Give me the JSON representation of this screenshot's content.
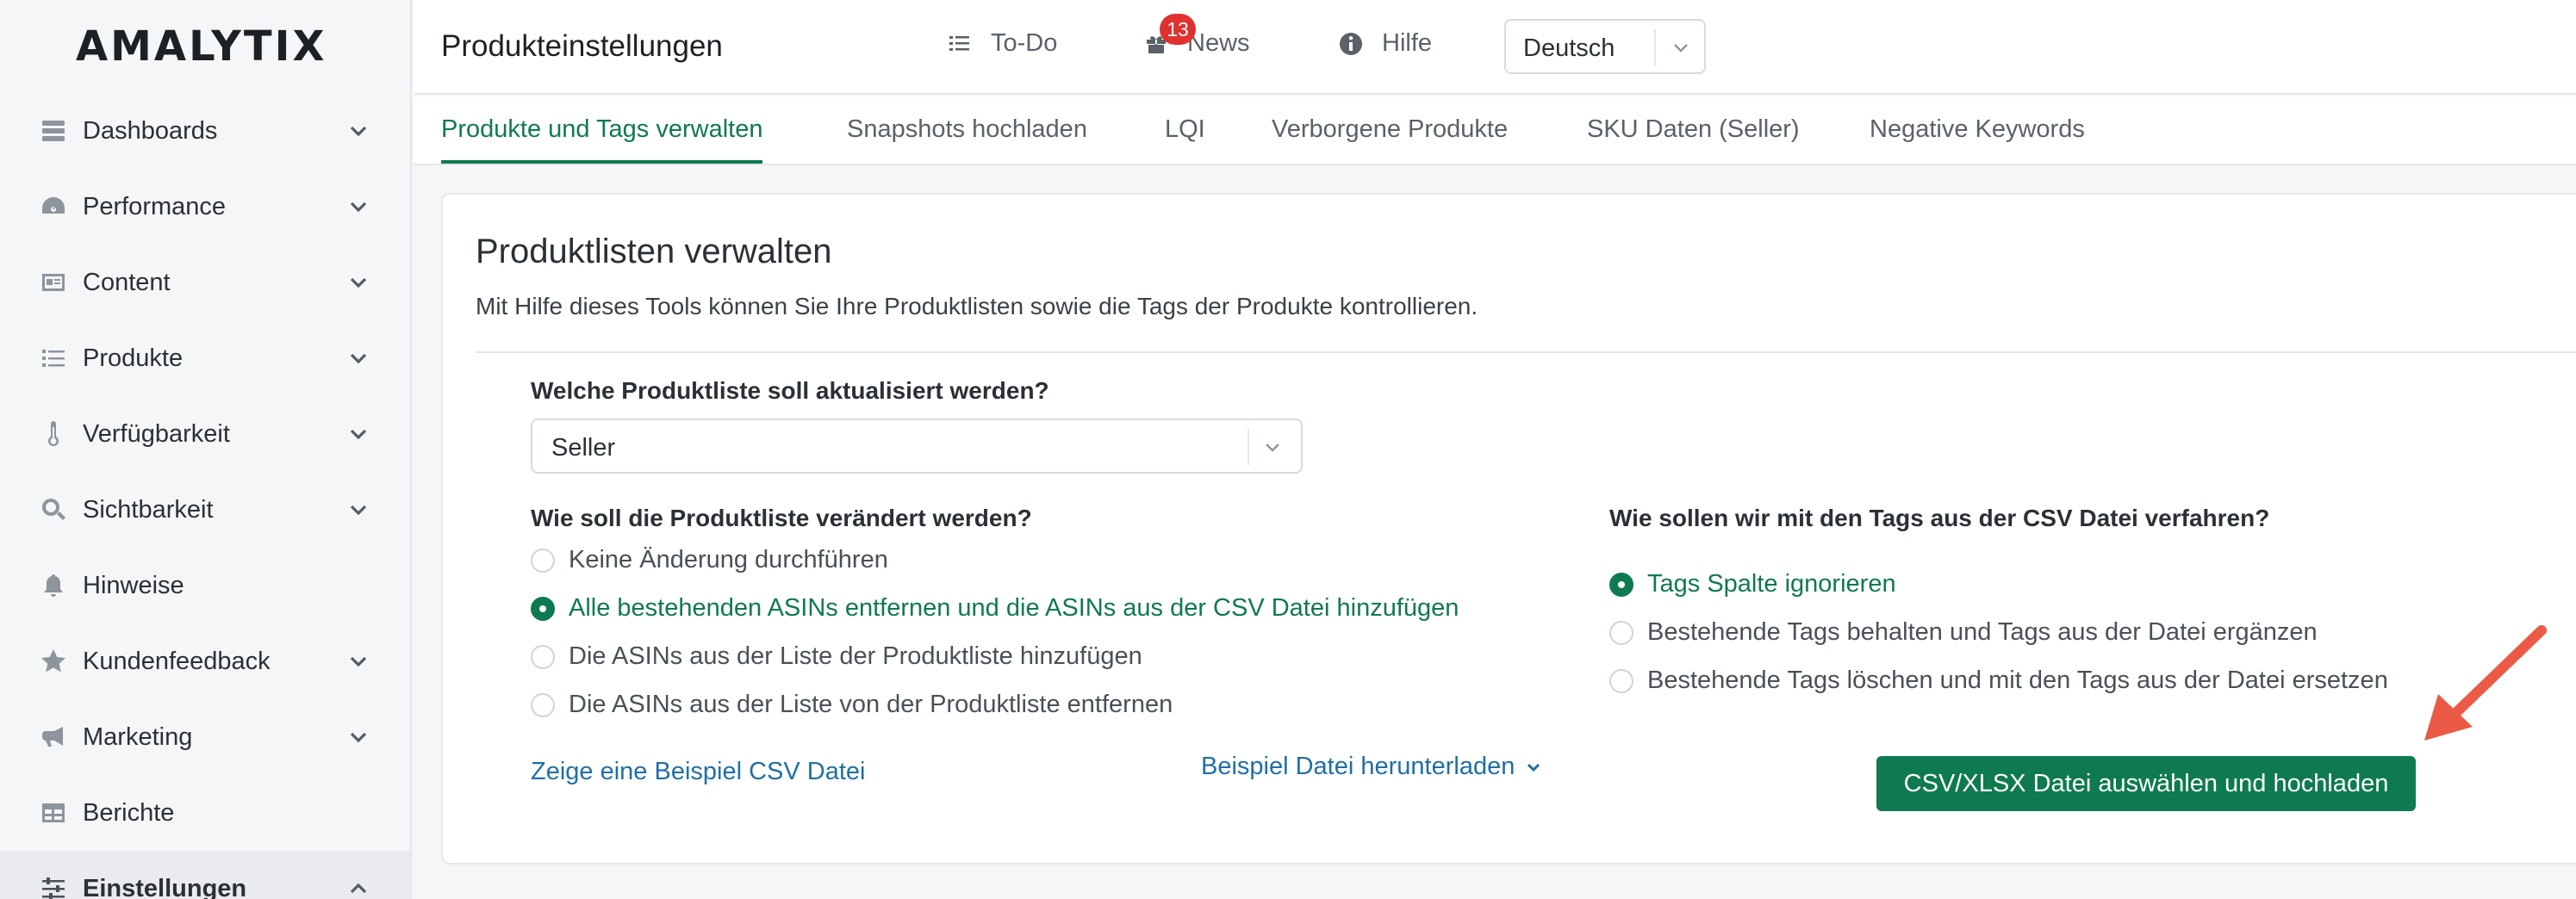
{
  "brand": {
    "logo": "AMALYTIX"
  },
  "sidebar": {
    "items": [
      {
        "label": "Dashboards",
        "icon": "server-icon"
      },
      {
        "label": "Performance",
        "icon": "gauge-icon"
      },
      {
        "label": "Content",
        "icon": "id-card-icon"
      },
      {
        "label": "Produkte",
        "icon": "list-icon"
      },
      {
        "label": "Verfügbarkeit",
        "icon": "thermometer-icon"
      },
      {
        "label": "Sichtbarkeit",
        "icon": "search-icon"
      },
      {
        "label": "Hinweise",
        "icon": "bell-icon"
      },
      {
        "label": "Kundenfeedback",
        "icon": "star-icon"
      },
      {
        "label": "Marketing",
        "icon": "megaphone-icon"
      },
      {
        "label": "Berichte",
        "icon": "table-icon"
      },
      {
        "label": "Einstellungen",
        "icon": "sliders-icon"
      }
    ]
  },
  "header": {
    "title": "Produkteinstellungen",
    "todo_label": "To-Do",
    "news_label": "News",
    "news_badge": "13",
    "help_label": "Hilfe",
    "language": "Deutsch"
  },
  "tabs": [
    {
      "label": "Produkte und Tags verwalten",
      "active": true
    },
    {
      "label": "Snapshots hochladen"
    },
    {
      "label": "LQI"
    },
    {
      "label": "Verborgene Produkte"
    },
    {
      "label": "SKU Daten (Seller)"
    },
    {
      "label": "Negative Keywords"
    }
  ],
  "card": {
    "title": "Produktlisten verwalten",
    "description": "Mit Hilfe dieses Tools können Sie Ihre Produktlisten sowie die Tags der Produkte kontrollieren.",
    "list_question": "Welche Produktliste soll aktualisiert werden?",
    "list_selected": "Seller",
    "change_question": "Wie soll die Produktliste verändert werden?",
    "change_options": [
      "Keine Änderung durchführen",
      "Alle bestehenden ASINs entfernen und die ASINs aus der CSV Datei hinzufügen",
      "Die ASINs aus der Liste der Produktliste hinzufügen",
      "Die ASINs aus der Liste von der Produktliste entfernen"
    ],
    "change_selected_index": 1,
    "tags_question": "Wie sollen wir mit den Tags aus der CSV Datei verfahren?",
    "tags_options": [
      "Tags Spalte ignorieren",
      "Bestehende Tags behalten und Tags aus der Datei ergänzen",
      "Bestehende Tags löschen und mit den Tags aus der Datei ersetzen"
    ],
    "tags_selected_index": 0,
    "example_link": "Zeige eine Beispiel CSV Datei",
    "download_link": "Beispiel Datei herunterladen",
    "upload_button": "CSV/XLSX Datei auswählen und hochladen"
  },
  "colors": {
    "accent": "#0e7a4f",
    "link": "#1f6fa6",
    "badge": "#e03131",
    "annotation_arrow": "#ea5a47"
  }
}
